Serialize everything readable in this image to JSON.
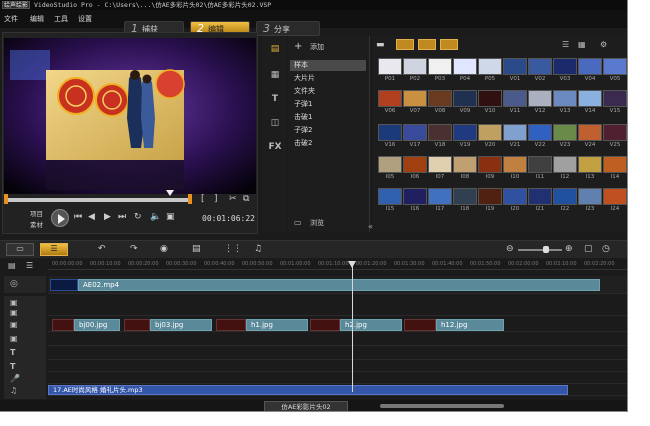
{
  "window": {
    "logo": "绘声绘影",
    "title": "VideoStudio Pro - C:\\Users\\...\\仿AE多彩片头02\\仿AE多彩片头02.VSP"
  },
  "menu": [
    "文件",
    "编辑",
    "工具",
    "设置"
  ],
  "steps": [
    {
      "num": "1",
      "label": "捕获",
      "active": false
    },
    {
      "num": "2",
      "label": "编辑",
      "active": true
    },
    {
      "num": "3",
      "label": "分享",
      "active": false
    }
  ],
  "player": {
    "mode_top": "项目",
    "mode_bottom": "素材",
    "timecode": "00:01:06:22",
    "progress": 0.85
  },
  "library": {
    "add_label": "添加",
    "browse_label": "浏览",
    "folders": [
      "样本",
      "大片片",
      "文件夹",
      "子弹1",
      "击破1",
      "子弹2",
      "击破2"
    ],
    "selected_folder": 0,
    "thumbs": [
      "P01",
      "P02",
      "P03",
      "P04",
      "P05",
      "V01",
      "V02",
      "V03",
      "V04",
      "V05",
      "V06",
      "V07",
      "V08",
      "V09",
      "V10",
      "V11",
      "V12",
      "V13",
      "V14",
      "V15",
      "V16",
      "V17",
      "V18",
      "V19",
      "V20",
      "V21",
      "V22",
      "V23",
      "V24",
      "V25",
      "I05",
      "I06",
      "I07",
      "I08",
      "I09",
      "I10",
      "I11",
      "I12",
      "I13",
      "I14",
      "I15",
      "I16",
      "I17",
      "I18",
      "I19",
      "I20",
      "I21",
      "I22",
      "I23",
      "I24"
    ]
  },
  "timeline": {
    "ruler": [
      "00:00:00:00",
      "00:00:10:00",
      "00:00:20:00",
      "00:00:30:00",
      "00:00:40:00",
      "00:00:50:00",
      "00:01:00:00",
      "00:01:10:00",
      "00:01:20:00",
      "00:01:30:00",
      "00:01:40:00",
      "00:01:50:00",
      "00:02:00:00",
      "00:02:10:00",
      "00:02:20:00"
    ],
    "video_clip": "AE02.mp4",
    "overlay_clips": [
      "bj00.jpg",
      "bj03.jpg",
      "h1.jpg",
      "h2.jpg",
      "h12.jpg"
    ],
    "audio_clip": "17.AE时尚风格 婚礼片头.mp3",
    "project_name": "仿AE彩影片头02"
  }
}
